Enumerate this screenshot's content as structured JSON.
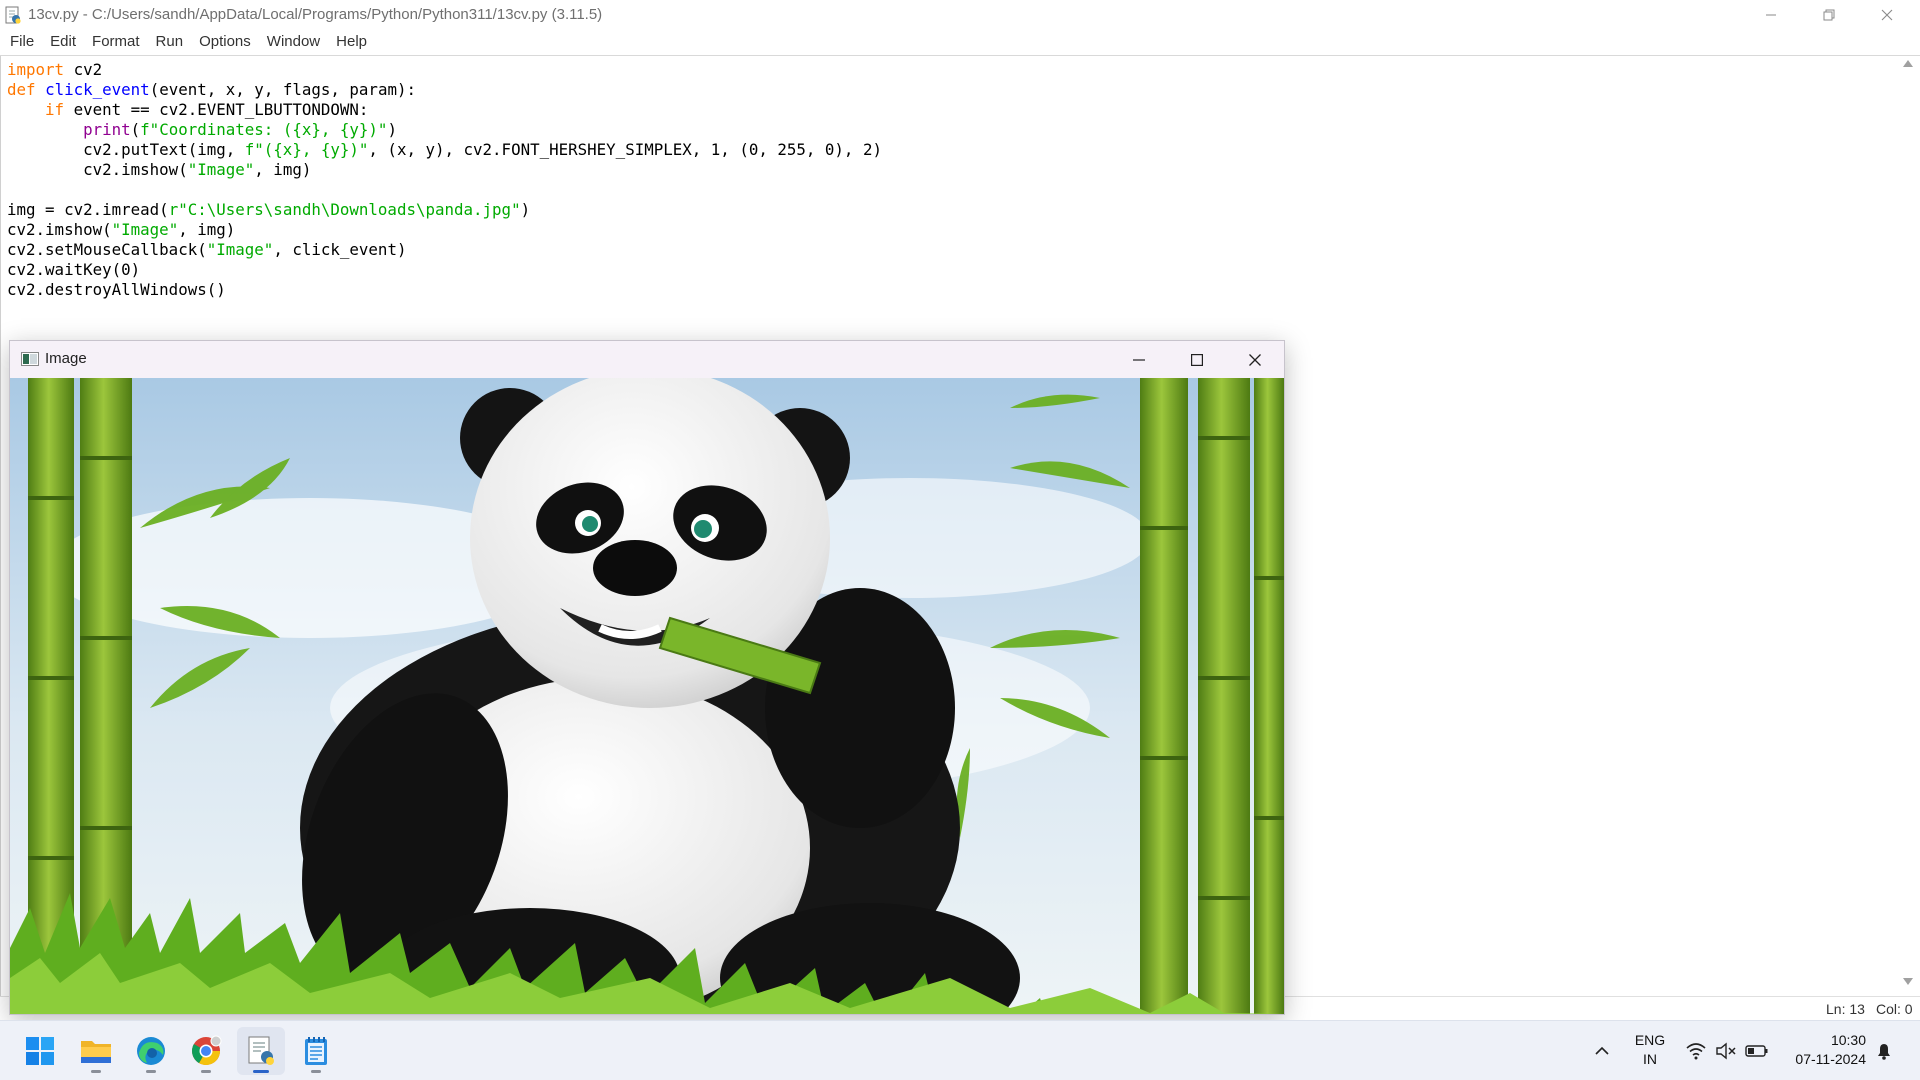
{
  "window": {
    "title": "13cv.py - C:/Users/sandh/AppData/Local/Programs/Python/Python311/13cv.py (3.11.5)"
  },
  "menu": [
    "File",
    "Edit",
    "Format",
    "Run",
    "Options",
    "Window",
    "Help"
  ],
  "code_lines": [
    [
      {
        "t": "import",
        "c": "kw"
      },
      {
        "t": " cv2",
        "c": "pl"
      }
    ],
    [
      {
        "t": "def",
        "c": "kw"
      },
      {
        "t": " ",
        "c": "pl"
      },
      {
        "t": "click_event",
        "c": "df"
      },
      {
        "t": "(event, x, y, flags, param):",
        "c": "pl"
      }
    ],
    [
      {
        "t": "    ",
        "c": "pl"
      },
      {
        "t": "if",
        "c": "kw"
      },
      {
        "t": " event == cv2.EVENT_LBUTTONDOWN:",
        "c": "pl"
      }
    ],
    [
      {
        "t": "        ",
        "c": "pl"
      },
      {
        "t": "print",
        "c": "bi"
      },
      {
        "t": "(",
        "c": "pl"
      },
      {
        "t": "f\"Coordinates: ({x}, {y})\"",
        "c": "st"
      },
      {
        "t": ")",
        "c": "pl"
      }
    ],
    [
      {
        "t": "        cv2.putText(img, ",
        "c": "pl"
      },
      {
        "t": "f\"({x}, {y})\"",
        "c": "st"
      },
      {
        "t": ", (x, y), cv2.FONT_HERSHEY_SIMPLEX, 1, (0, 255, 0), 2)",
        "c": "pl"
      }
    ],
    [
      {
        "t": "        cv2.imshow(",
        "c": "pl"
      },
      {
        "t": "\"Image\"",
        "c": "st"
      },
      {
        "t": ", img)",
        "c": "pl"
      }
    ],
    [],
    [
      {
        "t": "img = cv2.imread(",
        "c": "pl"
      },
      {
        "t": "r\"C:\\Users\\sandh\\Downloads\\panda.jpg\"",
        "c": "st"
      },
      {
        "t": ")",
        "c": "pl"
      }
    ],
    [
      {
        "t": "cv2.imshow(",
        "c": "pl"
      },
      {
        "t": "\"Image\"",
        "c": "st"
      },
      {
        "t": ", img)",
        "c": "pl"
      }
    ],
    [
      {
        "t": "cv2.setMouseCallback(",
        "c": "pl"
      },
      {
        "t": "\"Image\"",
        "c": "st"
      },
      {
        "t": ", click_event)",
        "c": "pl"
      }
    ],
    [
      {
        "t": "cv2.waitKey(0)",
        "c": "pl"
      }
    ],
    [
      {
        "t": "cv2.destroyAllWindows()",
        "c": "pl"
      }
    ]
  ],
  "status": {
    "line": "Ln: 13",
    "col": "Col: 0"
  },
  "image_window": {
    "title": "Image"
  },
  "taskbar": {
    "apps": [
      {
        "name": "start-button",
        "icon": "windows-logo-icon",
        "active": false,
        "running": false
      },
      {
        "name": "taskbar-file-explorer",
        "icon": "folder-icon",
        "active": false,
        "running": true
      },
      {
        "name": "taskbar-edge",
        "icon": "edge-icon",
        "active": false,
        "running": true
      },
      {
        "name": "taskbar-chrome",
        "icon": "chrome-icon",
        "active": false,
        "running": true
      },
      {
        "name": "taskbar-python-idle",
        "icon": "python-idle-icon",
        "active": true,
        "running": true
      },
      {
        "name": "taskbar-notepad",
        "icon": "notepad-icon",
        "active": false,
        "running": true
      }
    ],
    "lang_top": "ENG",
    "lang_bottom": "IN",
    "time": "10:30",
    "date": "07-11-2024"
  },
  "colors": {
    "keyword": "#ff7700",
    "builtin": "#900090",
    "string": "#00aa00",
    "definition": "#0000ff",
    "taskbar_bg": "#eef1f8",
    "sky": "#bcd6ea",
    "bamboo": "#7aa82a",
    "grass": "#5fae1f"
  }
}
